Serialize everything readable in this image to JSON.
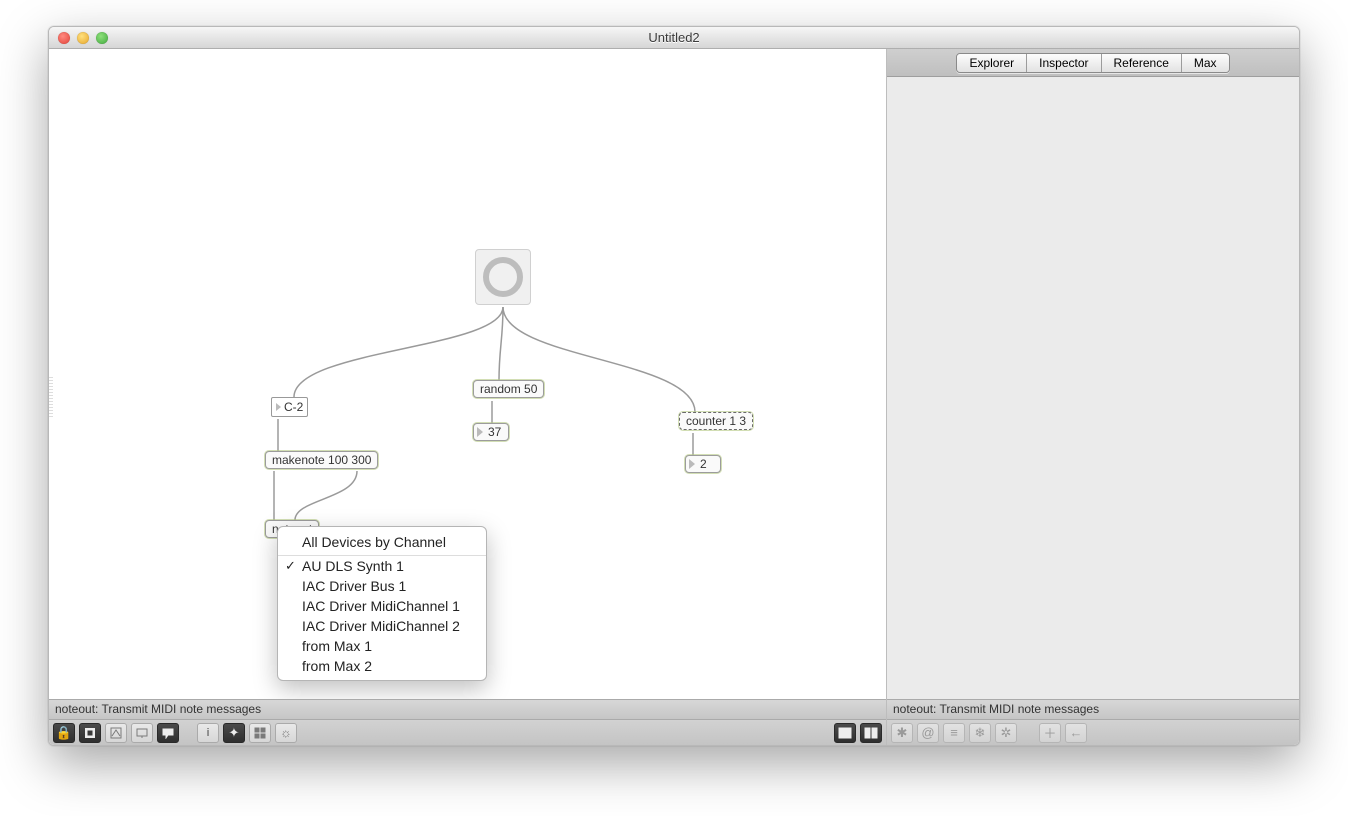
{
  "window_title": "Untitled2",
  "tabs": [
    "Explorer",
    "Inspector",
    "Reference",
    "Max"
  ],
  "status_text": "noteout: Transmit MIDI note messages",
  "side_status_text": "noteout: Transmit MIDI note messages",
  "patch": {
    "kslider_value": "C-2",
    "makenote": "makenote 100 300",
    "noteout": "noteout",
    "random": "random 50",
    "random_num": "37",
    "counter": "counter 1 3",
    "counter_num": "2"
  },
  "context_menu": {
    "header": "All Devices by Channel",
    "selected_index": 0,
    "items": [
      "AU DLS Synth 1",
      "IAC Driver Bus 1",
      "IAC Driver MidiChannel 1",
      "IAC Driver MidiChannel 2",
      "from Max 1",
      "from Max 2"
    ]
  },
  "patcher_toolbar_icons": [
    "lock",
    "new",
    "patch-toggle",
    "present",
    "message",
    "info",
    "debug",
    "grid",
    "sun"
  ],
  "patcher_toolbar_right": [
    "view-single",
    "view-split"
  ],
  "side_toolbar_icons": [
    "snowflake",
    "at",
    "list",
    "style",
    "gear",
    "plus",
    "back"
  ]
}
